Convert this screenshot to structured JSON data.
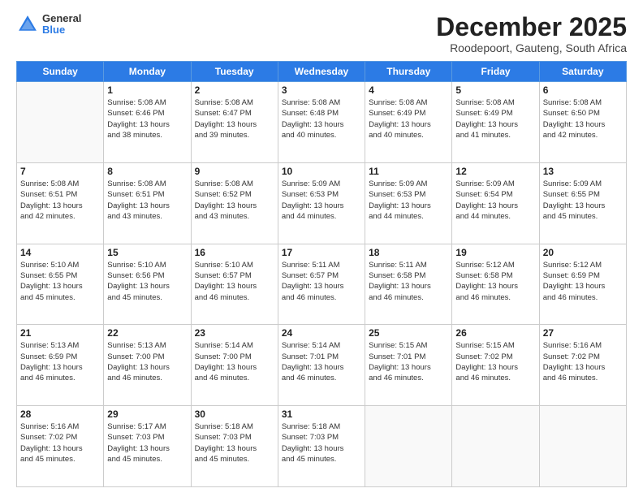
{
  "header": {
    "logo_general": "General",
    "logo_blue": "Blue",
    "month_title": "December 2025",
    "location": "Roodepoort, Gauteng, South Africa"
  },
  "days_header": [
    "Sunday",
    "Monday",
    "Tuesday",
    "Wednesday",
    "Thursday",
    "Friday",
    "Saturday"
  ],
  "weeks": [
    [
      {
        "day": "",
        "info": ""
      },
      {
        "day": "1",
        "info": "Sunrise: 5:08 AM\nSunset: 6:46 PM\nDaylight: 13 hours\nand 38 minutes."
      },
      {
        "day": "2",
        "info": "Sunrise: 5:08 AM\nSunset: 6:47 PM\nDaylight: 13 hours\nand 39 minutes."
      },
      {
        "day": "3",
        "info": "Sunrise: 5:08 AM\nSunset: 6:48 PM\nDaylight: 13 hours\nand 40 minutes."
      },
      {
        "day": "4",
        "info": "Sunrise: 5:08 AM\nSunset: 6:49 PM\nDaylight: 13 hours\nand 40 minutes."
      },
      {
        "day": "5",
        "info": "Sunrise: 5:08 AM\nSunset: 6:49 PM\nDaylight: 13 hours\nand 41 minutes."
      },
      {
        "day": "6",
        "info": "Sunrise: 5:08 AM\nSunset: 6:50 PM\nDaylight: 13 hours\nand 42 minutes."
      }
    ],
    [
      {
        "day": "7",
        "info": "Sunrise: 5:08 AM\nSunset: 6:51 PM\nDaylight: 13 hours\nand 42 minutes."
      },
      {
        "day": "8",
        "info": "Sunrise: 5:08 AM\nSunset: 6:51 PM\nDaylight: 13 hours\nand 43 minutes."
      },
      {
        "day": "9",
        "info": "Sunrise: 5:08 AM\nSunset: 6:52 PM\nDaylight: 13 hours\nand 43 minutes."
      },
      {
        "day": "10",
        "info": "Sunrise: 5:09 AM\nSunset: 6:53 PM\nDaylight: 13 hours\nand 44 minutes."
      },
      {
        "day": "11",
        "info": "Sunrise: 5:09 AM\nSunset: 6:53 PM\nDaylight: 13 hours\nand 44 minutes."
      },
      {
        "day": "12",
        "info": "Sunrise: 5:09 AM\nSunset: 6:54 PM\nDaylight: 13 hours\nand 44 minutes."
      },
      {
        "day": "13",
        "info": "Sunrise: 5:09 AM\nSunset: 6:55 PM\nDaylight: 13 hours\nand 45 minutes."
      }
    ],
    [
      {
        "day": "14",
        "info": "Sunrise: 5:10 AM\nSunset: 6:55 PM\nDaylight: 13 hours\nand 45 minutes."
      },
      {
        "day": "15",
        "info": "Sunrise: 5:10 AM\nSunset: 6:56 PM\nDaylight: 13 hours\nand 45 minutes."
      },
      {
        "day": "16",
        "info": "Sunrise: 5:10 AM\nSunset: 6:57 PM\nDaylight: 13 hours\nand 46 minutes."
      },
      {
        "day": "17",
        "info": "Sunrise: 5:11 AM\nSunset: 6:57 PM\nDaylight: 13 hours\nand 46 minutes."
      },
      {
        "day": "18",
        "info": "Sunrise: 5:11 AM\nSunset: 6:58 PM\nDaylight: 13 hours\nand 46 minutes."
      },
      {
        "day": "19",
        "info": "Sunrise: 5:12 AM\nSunset: 6:58 PM\nDaylight: 13 hours\nand 46 minutes."
      },
      {
        "day": "20",
        "info": "Sunrise: 5:12 AM\nSunset: 6:59 PM\nDaylight: 13 hours\nand 46 minutes."
      }
    ],
    [
      {
        "day": "21",
        "info": "Sunrise: 5:13 AM\nSunset: 6:59 PM\nDaylight: 13 hours\nand 46 minutes."
      },
      {
        "day": "22",
        "info": "Sunrise: 5:13 AM\nSunset: 7:00 PM\nDaylight: 13 hours\nand 46 minutes."
      },
      {
        "day": "23",
        "info": "Sunrise: 5:14 AM\nSunset: 7:00 PM\nDaylight: 13 hours\nand 46 minutes."
      },
      {
        "day": "24",
        "info": "Sunrise: 5:14 AM\nSunset: 7:01 PM\nDaylight: 13 hours\nand 46 minutes."
      },
      {
        "day": "25",
        "info": "Sunrise: 5:15 AM\nSunset: 7:01 PM\nDaylight: 13 hours\nand 46 minutes."
      },
      {
        "day": "26",
        "info": "Sunrise: 5:15 AM\nSunset: 7:02 PM\nDaylight: 13 hours\nand 46 minutes."
      },
      {
        "day": "27",
        "info": "Sunrise: 5:16 AM\nSunset: 7:02 PM\nDaylight: 13 hours\nand 46 minutes."
      }
    ],
    [
      {
        "day": "28",
        "info": "Sunrise: 5:16 AM\nSunset: 7:02 PM\nDaylight: 13 hours\nand 45 minutes."
      },
      {
        "day": "29",
        "info": "Sunrise: 5:17 AM\nSunset: 7:03 PM\nDaylight: 13 hours\nand 45 minutes."
      },
      {
        "day": "30",
        "info": "Sunrise: 5:18 AM\nSunset: 7:03 PM\nDaylight: 13 hours\nand 45 minutes."
      },
      {
        "day": "31",
        "info": "Sunrise: 5:18 AM\nSunset: 7:03 PM\nDaylight: 13 hours\nand 45 minutes."
      },
      {
        "day": "",
        "info": ""
      },
      {
        "day": "",
        "info": ""
      },
      {
        "day": "",
        "info": ""
      }
    ]
  ]
}
